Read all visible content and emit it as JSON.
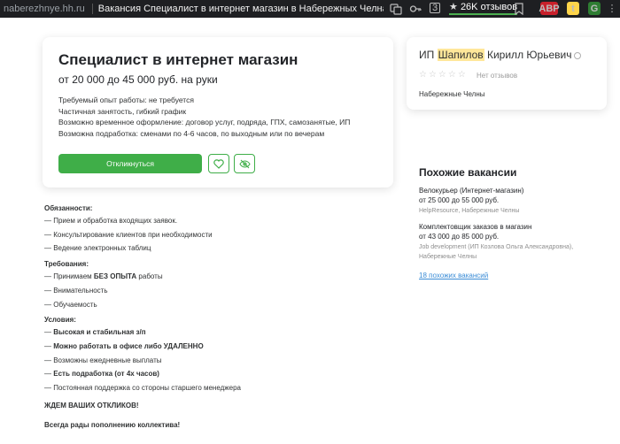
{
  "browser": {
    "domain": "naberezhnye.hh.ru",
    "title": "Вакансия Специалист в интернет магазин в Набережных Челнах, ра...",
    "reviews_badge": "26K отзывов",
    "square_badge": "3",
    "ext_abp": "ABP",
    "ext_t": "t",
    "ext_g": "G"
  },
  "vacancy": {
    "title": "Специалист в интернет магазин",
    "salary": "от 20 000 до 45 000 руб. на руки",
    "details": [
      "Требуемый опыт работы: не требуется",
      "Частичная занятость, гибкий график",
      "Возможно временное оформление: договор услуг, подряда, ГПХ, самозанятые, ИП",
      "Возможна подработка: сменами по 4-6 часов, по выходным или по вечерам"
    ],
    "apply_label": "Откликнуться"
  },
  "employer": {
    "prefix": "ИП ",
    "highlight": "Шапилов",
    "rest": " Кирилл Юрьевич",
    "stars": "☆☆☆☆☆",
    "no_reviews": "Нет отзывов",
    "city": "Набережные Челны"
  },
  "similar": {
    "heading": "Похожие вакансии",
    "items": [
      {
        "title": "Велокурьер (Интернет-магазин)",
        "salary": "от 25 000 до 55 000 руб.",
        "company": [
          "HelpResource, Набережные Челны"
        ]
      },
      {
        "title": "Комплектовщик заказов в магазин",
        "salary": "от 43 000 до 85 000 руб.",
        "company": [
          "Job development (ИП Козлова Ольга Александровна),",
          "Набережные Челны"
        ]
      }
    ],
    "more_link": "18 похожих вакансий"
  },
  "description": {
    "duties_heading": "Обязанности:",
    "duties": [
      "— Прием и обработка входящих заявок.",
      "— Консультирование клиентов при необходимости",
      "— Ведение электронных таблиц"
    ],
    "req_heading": "Требования:",
    "req": [
      {
        "pre": "— Принимаем ",
        "bold": "БЕЗ ОПЫТА",
        "post": " работы"
      },
      {
        "pre": "— Внимательность",
        "bold": "",
        "post": ""
      },
      {
        "pre": "— Обучаемость",
        "bold": "",
        "post": ""
      }
    ],
    "cond_heading": "Условия:",
    "cond": [
      {
        "pre": "— ",
        "bold": "Высокая и стабильная з/п",
        "post": ""
      },
      {
        "pre": "— ",
        "bold": "Можно работать в офисе либо УДАЛЕННО",
        "post": ""
      },
      {
        "pre": "— Возможны ежедневные выплаты",
        "bold": "",
        "post": ""
      },
      {
        "pre": "— ",
        "bold": "Есть подработка (от 4х часов)",
        "post": ""
      },
      {
        "pre": "— Постоянная поддержка со стороны старшего менеджера",
        "bold": "",
        "post": ""
      }
    ],
    "note1": "ЖДЕМ ВАШИХ ОТКЛИКОВ!",
    "note2": "Всегда рады пополнению коллектива!"
  }
}
